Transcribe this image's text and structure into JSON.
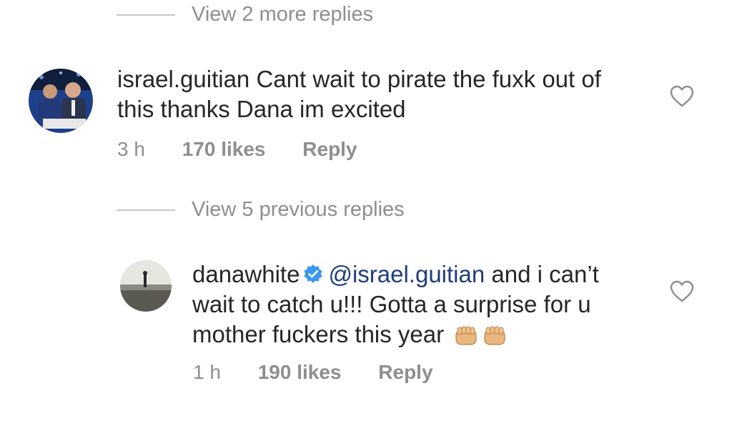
{
  "thread_top": {
    "view_more_label": "View 2 more replies"
  },
  "comment1": {
    "username": "israel.guitian",
    "text_line1": "Cant wait to pirate the fuxk out of",
    "text_line2": "this thanks Dana im excited",
    "time": "3 h",
    "likes": "170 likes",
    "reply_label": "Reply"
  },
  "thread_mid": {
    "view_previous_label": "View 5 previous replies"
  },
  "comment2": {
    "username": "danawhite",
    "mention": "@israel.guitian",
    "text_after_mention": "and i can’t",
    "text_line2": "wait to catch u!!! Gotta a surprise for u",
    "text_line3": "mother fuckers this year",
    "emoji": [
      "oncoming-fist",
      "oncoming-fist"
    ],
    "time": "1 h",
    "likes": "190 likes",
    "reply_label": "Reply"
  },
  "colors": {
    "text": "#262626",
    "secondary": "#8e8e8e",
    "mention": "#1f3d7a",
    "verified": "#3897f0",
    "divider": "#c7c7c7"
  },
  "icons": [
    "heart-icon",
    "verified-badge-icon",
    "fist-emoji"
  ]
}
